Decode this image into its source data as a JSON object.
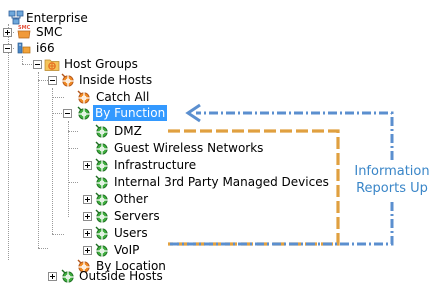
{
  "tree": {
    "root": {
      "label": "Enterprise",
      "icon": "enterprise-network-icon"
    },
    "smc": {
      "label": "SMC",
      "icon": "smc-server-icon"
    },
    "i66": {
      "label": "i66",
      "icon": "network-device-icon"
    },
    "host_groups": {
      "label": "Host Groups",
      "icon": "folder-hostgroup-icon"
    },
    "inside_hosts": {
      "label": "Inside Hosts",
      "icon": "host-group-orange-icon"
    },
    "catch_all": {
      "label": "Catch All",
      "icon": "host-group-orange-icon"
    },
    "by_function": {
      "label": "By Function",
      "icon": "host-group-green-icon",
      "selected": true
    },
    "by_function_children": [
      {
        "label": "DMZ",
        "icon": "host-group-green-icon"
      },
      {
        "label": "Guest Wireless Networks",
        "icon": "host-group-green-icon"
      },
      {
        "label": "Infrastructure",
        "icon": "host-group-green-icon"
      },
      {
        "label": "Internal 3rd Party Managed Devices",
        "icon": "host-group-green-icon"
      },
      {
        "label": "Other",
        "icon": "host-group-green-icon"
      },
      {
        "label": "Servers",
        "icon": "host-group-green-icon"
      },
      {
        "label": "Users",
        "icon": "host-group-green-icon"
      },
      {
        "label": "VoIP",
        "icon": "host-group-green-icon"
      }
    ],
    "by_location": {
      "label": "By Location",
      "icon": "host-group-orange-icon"
    },
    "outside_hosts": {
      "label": "Outside Hosts",
      "icon": "host-group-green-icon"
    }
  },
  "annotation": {
    "line1": "Information",
    "line2": "Reports Up",
    "text_color": "#3a86c8",
    "blue_line_color": "#5b8fcf",
    "orange_line_color": "#e0a040"
  },
  "colors": {
    "selection": "#3399ff",
    "selection_text": "#ffffff"
  }
}
